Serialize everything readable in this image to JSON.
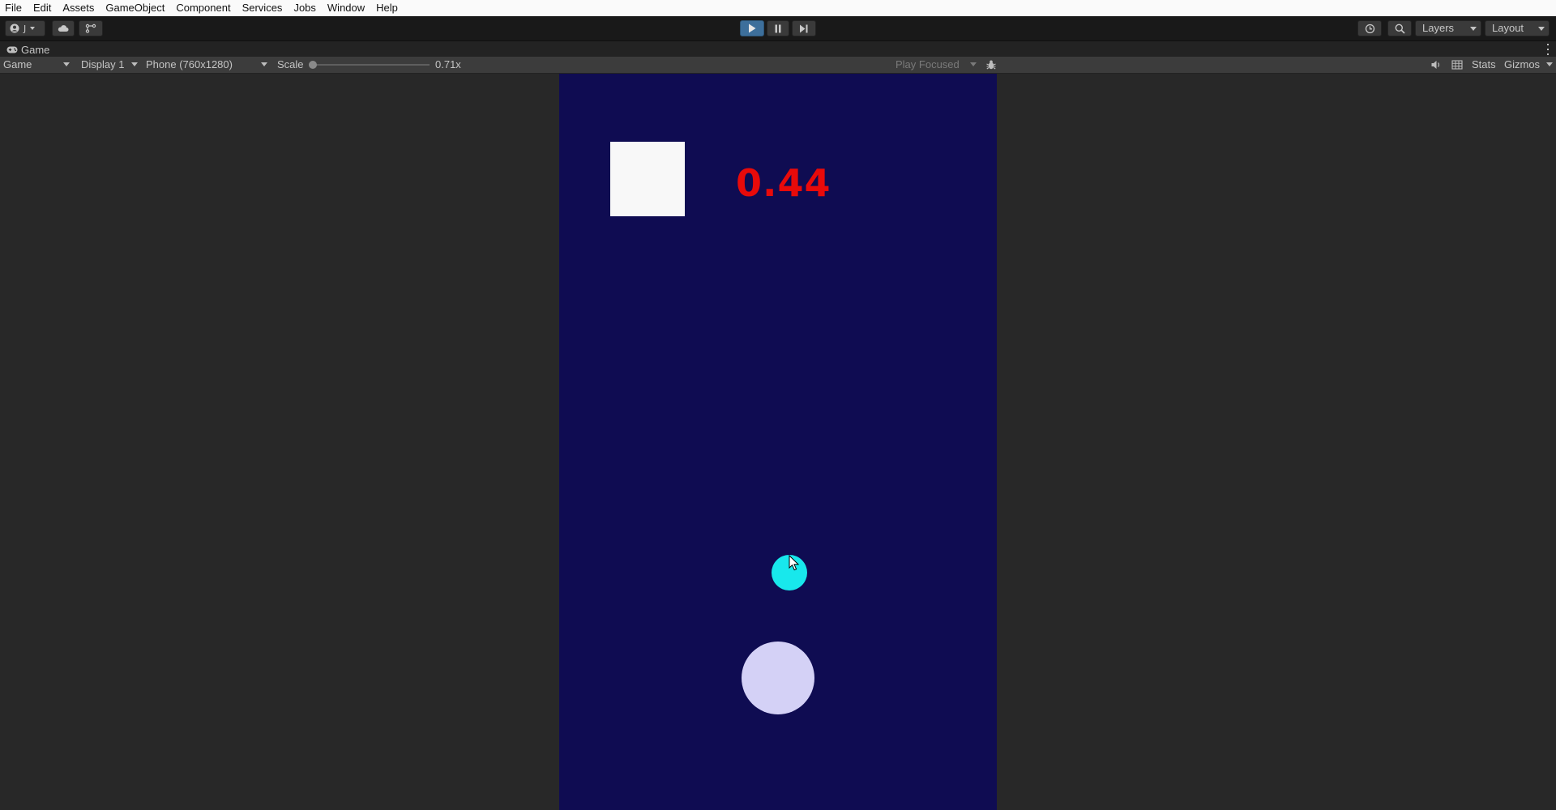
{
  "menu": {
    "items": [
      "File",
      "Edit",
      "Assets",
      "GameObject",
      "Component",
      "Services",
      "Jobs",
      "Window",
      "Help"
    ]
  },
  "toolbar": {
    "account_label": "J",
    "layers_label": "Layers",
    "layout_label": "Layout",
    "icons": [
      "account-icon",
      "cloud-icon",
      "version-control-icon",
      "play-icon",
      "pause-icon",
      "step-icon",
      "history-icon",
      "search-icon"
    ]
  },
  "tab": {
    "label": "Game",
    "icon": "gamepad-icon"
  },
  "gamebar": {
    "view_mode": "Game",
    "display": "Display 1",
    "resolution": "Phone (760x1280)",
    "scale_label": "Scale",
    "scale_value": "0.71x",
    "scale_fraction": 0.0,
    "play_mode": "Play Focused",
    "stats_label": "Stats",
    "gizmos_label": "Gizmos",
    "icons": [
      "bug-icon",
      "audio-icon",
      "grid-icon"
    ]
  },
  "game": {
    "timer_text": "0.44",
    "colors": {
      "background": "#0f0c52",
      "timer": "#e80a0a",
      "square": "#f8f8f8",
      "ball_small": "#18e8ec",
      "ball_large": "#d4d1f6"
    }
  }
}
